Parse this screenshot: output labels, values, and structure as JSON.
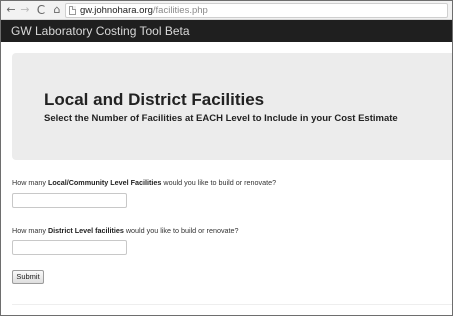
{
  "browser": {
    "back_icon": "←",
    "forward_icon": "→",
    "reload_icon": "C",
    "home_icon": "⌂",
    "url_host": "gw.johnohara.org",
    "url_path": "/facilities.php"
  },
  "navbar": {
    "brand": "GW Laboratory Costing Tool Beta"
  },
  "hero": {
    "title": "Local and District Facilities",
    "subtitle": "Select the Number of Facilities at EACH Level to Include in your Cost Estimate"
  },
  "form": {
    "q1": {
      "prefix": "How many ",
      "bold": "Local/Community Level Facilities",
      "suffix": " would you like to build or renovate?",
      "value": ""
    },
    "q2": {
      "prefix": "How many ",
      "bold": "District Level facilities",
      "suffix": " would you like to build or renovate?",
      "value": ""
    },
    "submit_label": "Submit"
  },
  "colors": {
    "navbar_bg": "#1f1f1f",
    "hero_bg": "#ececec"
  }
}
